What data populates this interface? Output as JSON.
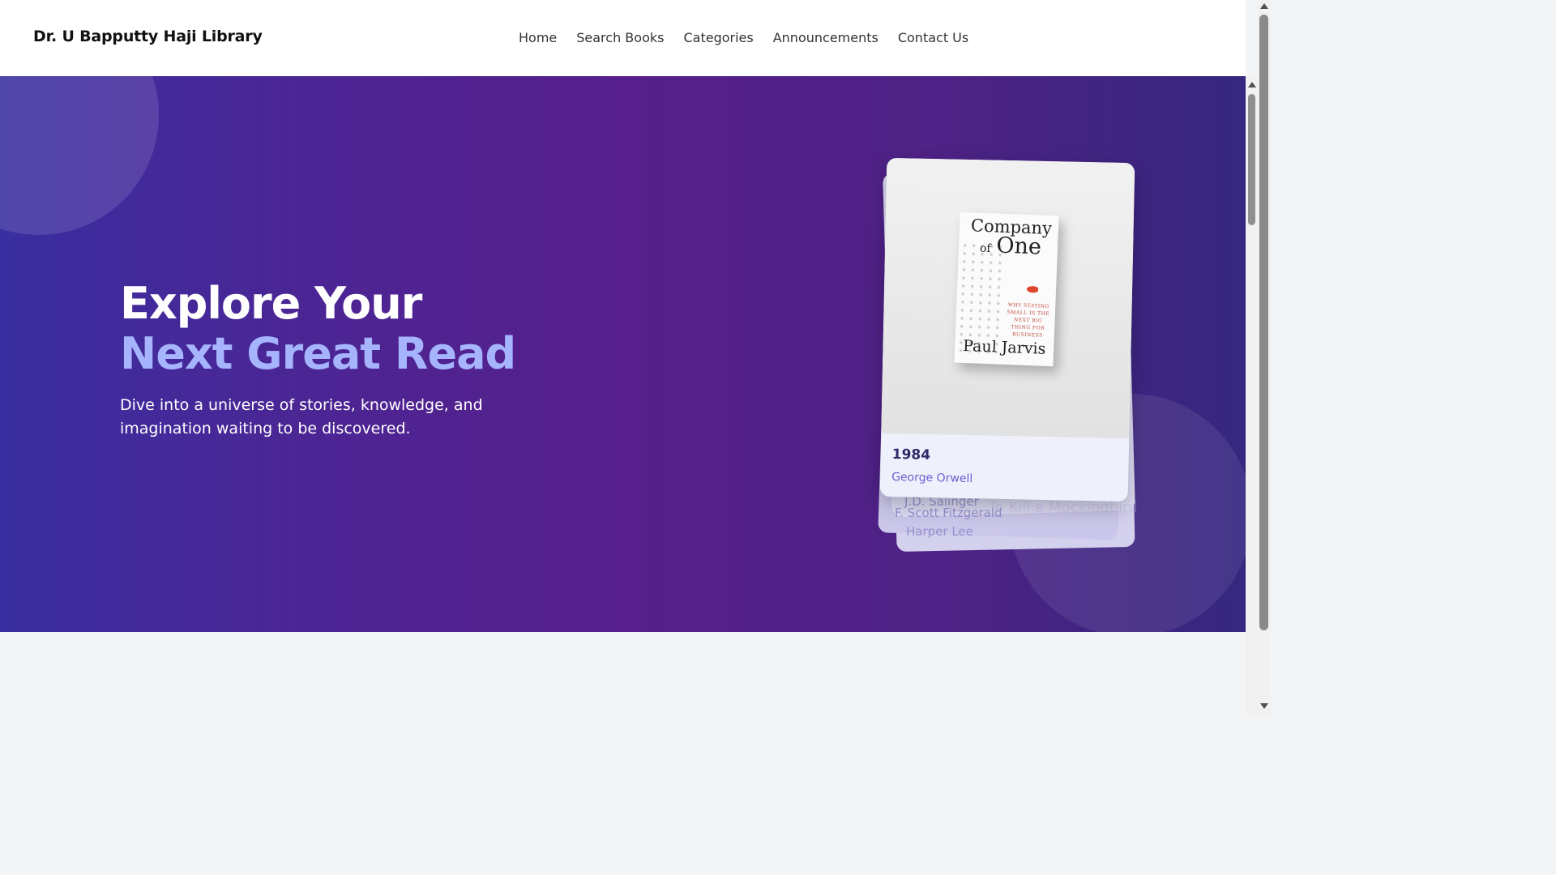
{
  "header": {
    "brand": "Dr. U Bapputty Haji Library",
    "nav": [
      "Home",
      "Search Books",
      "Categories",
      "Announcements",
      "Contact Us"
    ]
  },
  "hero": {
    "title_line1": "Explore Your",
    "title_line2": "Next Great Read",
    "subtitle": "Dive into a universe of stories, knowledge, and imagination waiting to be discovered.",
    "colors": {
      "gradient_start": "#3a2ea0",
      "gradient_mid": "#561f8b",
      "gradient_end": "#35277f",
      "title_accent": "#a5b4fc"
    }
  },
  "book_stack": {
    "featured": {
      "title": "1984",
      "author": "George Orwell",
      "cover": {
        "title_part1": "Company",
        "title_part2": "of",
        "title_part3": "One",
        "tagline": "WHY STAYING SMALL IS THE NEXT BIG THING FOR BUSINESS",
        "author": "Paul Jarvis"
      }
    },
    "behind": [
      {
        "author": "J.D. Salinger"
      },
      {
        "author": "F. Scott Fitzgerald"
      },
      {
        "title": "To Kill a Mockingbird",
        "author": "Harper Lee"
      }
    ]
  }
}
